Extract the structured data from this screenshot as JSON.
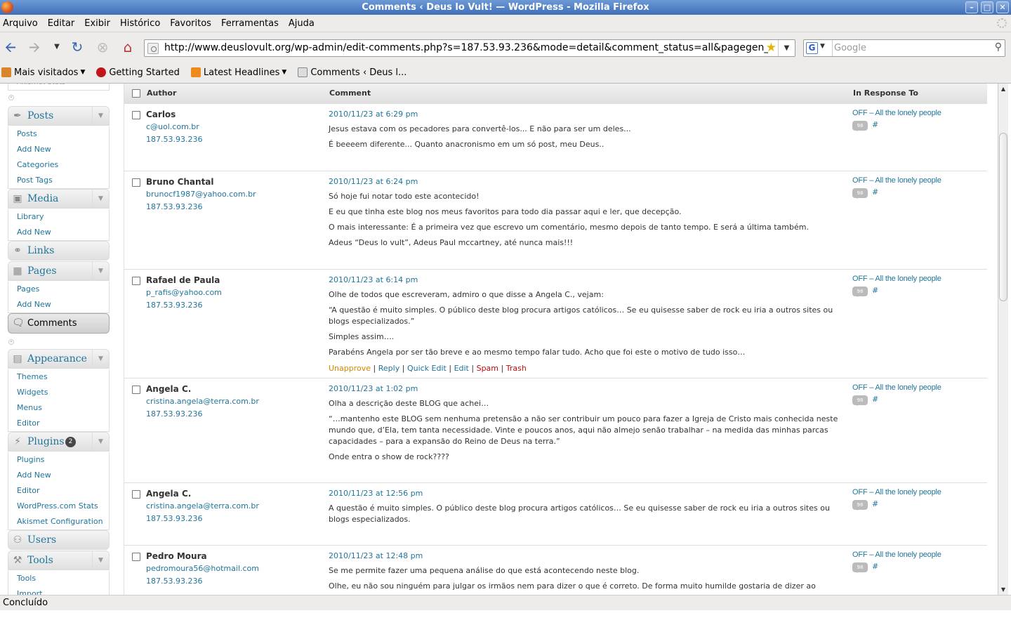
{
  "window": {
    "title": "Comments ‹ Deus lo Vult! — WordPress - Mozilla Firefox",
    "buttons": [
      "–",
      "□",
      "✕"
    ]
  },
  "menubar": [
    "Arquivo",
    "Editar",
    "Exibir",
    "Histórico",
    "Favoritos",
    "Ferramentas",
    "Ajuda"
  ],
  "nav": {
    "url": "http://www.deuslovult.org/wp-admin/edit-comments.php?s=187.53.93.236&mode=detail&comment_status=all&pagegen_timestam",
    "search_placeholder": "Google"
  },
  "bookmarks": [
    "Mais visitados",
    "Getting Started",
    "Latest Headlines",
    "Comments ‹ Deus l..."
  ],
  "sidebar": {
    "partial_top": "Akismet Stats",
    "posts": {
      "label": "Posts",
      "items": [
        "Posts",
        "Add New",
        "Categories",
        "Post Tags"
      ]
    },
    "media": {
      "label": "Media",
      "items": [
        "Library",
        "Add New"
      ]
    },
    "links": {
      "label": "Links"
    },
    "pages": {
      "label": "Pages",
      "items": [
        "Pages",
        "Add New"
      ]
    },
    "comments": {
      "label": "Comments"
    },
    "appearance": {
      "label": "Appearance",
      "items": [
        "Themes",
        "Widgets",
        "Menus",
        "Editor"
      ]
    },
    "plugins": {
      "label": "Plugins",
      "badge": "2",
      "items": [
        "Plugins",
        "Add New",
        "Editor",
        "WordPress.com Stats",
        "Akismet Configuration"
      ]
    },
    "users": {
      "label": "Users"
    },
    "tools": {
      "label": "Tools",
      "items": [
        "Tools",
        "Import"
      ]
    }
  },
  "table": {
    "headers": {
      "author": "Author",
      "comment": "Comment",
      "response": "In Response To"
    },
    "rows": [
      {
        "name": "Carlos",
        "email": "c@uol.com.br",
        "ip": "187.53.93.236",
        "date": "2010/11/23 at 6:29 pm",
        "paragraphs": [
          "Jesus estava com os pecadores para convertê-los... E não para ser um deles...",
          "É beeeem diferente... Quanto anacronismo em um só post, meu Deus.."
        ],
        "response": "OFF – All the lonely people",
        "count": "98",
        "hash": "#"
      },
      {
        "name": "Bruno Chantal",
        "email": "brunocf1987@yahoo.com.br",
        "ip": "187.53.93.236",
        "date": "2010/11/23 at 6:24 pm",
        "paragraphs": [
          "Só hoje fui notar todo este acontecido!",
          "E eu que tinha este blog nos meus favoritos para todo dia passar aqui e ler, que decepção.",
          "O mais interessante: É a primeira vez que escrevo um comentário, mesmo depois de tanto tempo. E será a última também.",
          "Adeus “Deus lo vult”, Adeus Paul mccartney, até nunca mais!!!"
        ],
        "response": "OFF – All the lonely people",
        "count": "98",
        "hash": "#"
      },
      {
        "name": "Rafael de Paula",
        "email": "p_rafis@yahoo.com",
        "ip": "187.53.93.236",
        "date": "2010/11/23 at 6:14 pm",
        "paragraphs": [
          "Olhe de todos que escreveram, admiro o que disse a Angela C., vejam:",
          "“A questão é muito simples. O público deste blog procura artigos católicos… Se eu quisesse saber de rock eu iria a outros sites ou blogs especializados.”",
          "Simples assim….",
          "Parabéns Angela por ser tão breve e ao mesmo tempo falar tudo. Acho que foi este o motivo de tudo isso…"
        ],
        "actions": {
          "unapprove": "Unapprove",
          "reply": "Reply",
          "quick_edit": "Quick Edit",
          "edit": "Edit",
          "spam": "Spam",
          "trash": "Trash",
          "sep": "|"
        },
        "response": "OFF – All the lonely people",
        "count": "98",
        "hash": "#"
      },
      {
        "name": "Angela C.",
        "email": "cristina.angela@terra.com.br",
        "ip": "187.53.93.236",
        "date": "2010/11/23 at 1:02 pm",
        "paragraphs": [
          "Olha a descrição deste BLOG que achei…",
          "“…mantenho este BLOG sem nenhuma pretensão a não ser contribuir um pouco para fazer a Igreja de Cristo mais conhecida neste mundo que, d’Ela, tem tanta necessidade. Vinte e poucos anos, aqui não almejo senão trabalhar – na medida das minhas parcas capacidades – para a expansão do Reino de Deus na terra.”",
          "Onde entra o show de rock????"
        ],
        "response": "OFF – All the lonely people",
        "count": "98",
        "hash": "#"
      },
      {
        "name": "Angela C.",
        "email": "cristina.angela@terra.com.br",
        "ip": "187.53.93.236",
        "date": "2010/11/23 at 12:56 pm",
        "paragraphs": [
          "A questão é muito simples. O público deste blog procura artigos católicos… Se eu quisesse saber de rock eu iria a outros sites ou blogs especializados."
        ],
        "response": "OFF – All the lonely people",
        "count": "98",
        "hash": "#"
      },
      {
        "name": "Pedro Moura",
        "email": "pedromoura56@hotmail.com",
        "ip": "187.53.93.236",
        "date": "2010/11/23 at 12:48 pm",
        "paragraphs": [
          "Se me permite fazer uma pequena análise do que está acontecendo neste blog.",
          "Olhe, eu não sou ninguém para julgar os irmãos nem para dizer o que é correto. De forma muito humilde gostaria de dizer ao"
        ],
        "response": "OFF – All the lonely people",
        "count": "98",
        "hash": "#"
      }
    ]
  },
  "status": "Concluído",
  "colors": {
    "link": "#21759b",
    "unapprove": "#d98500",
    "danger": "#bc0b0b",
    "titlebar": "#4a7cc2"
  }
}
